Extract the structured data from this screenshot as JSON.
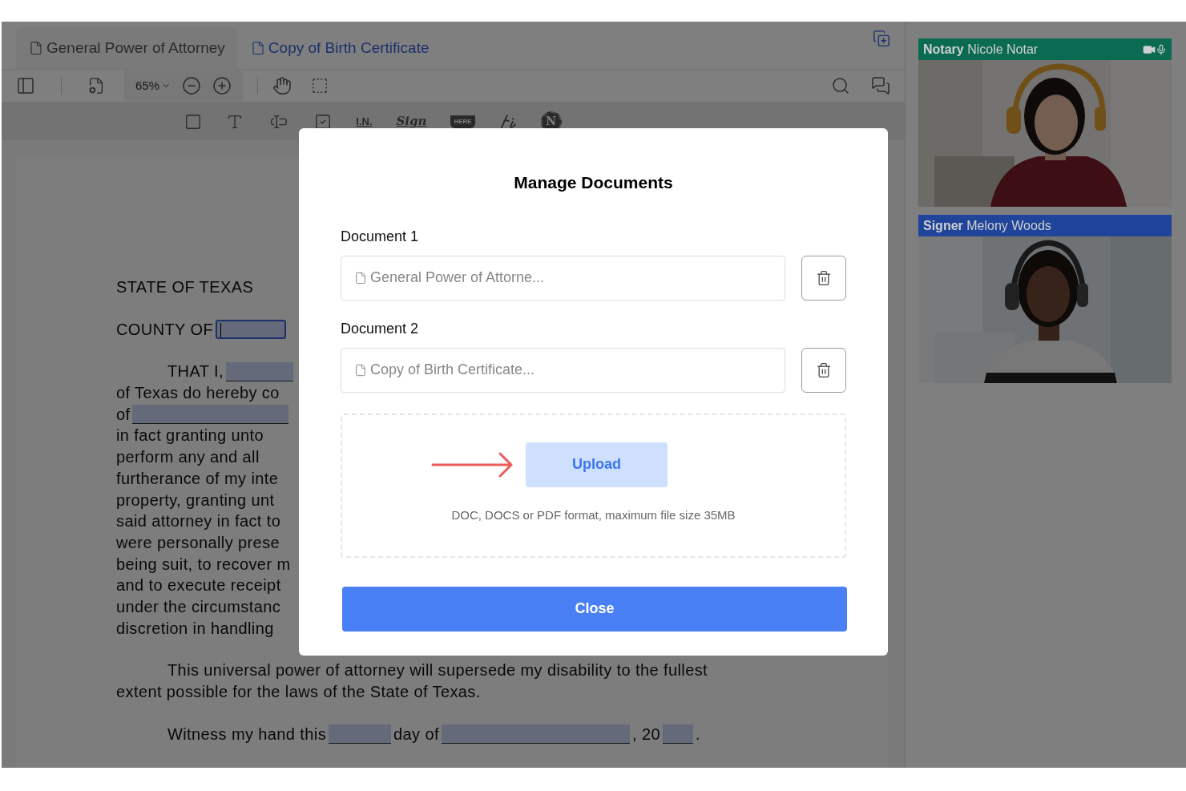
{
  "tabs": [
    {
      "label": "General Power of Attorney",
      "selected": false
    },
    {
      "label": "Copy of Birth Certificate",
      "selected": true
    }
  ],
  "toolbar": {
    "zoom": "65%"
  },
  "field_tools": [
    {
      "kind": "square"
    },
    {
      "kind": "letter"
    },
    {
      "kind": "textbox"
    },
    {
      "kind": "checkbox"
    },
    {
      "kind": "caption",
      "label": "I.N."
    },
    {
      "kind": "script",
      "label": "Sign"
    },
    {
      "kind": "stamp",
      "label": "HERE"
    },
    {
      "kind": "initials"
    },
    {
      "kind": "seal",
      "label": "N"
    }
  ],
  "document": {
    "blocks": [
      {
        "lines": [
          {
            "indent": false,
            "segments": [
              {
                "kind": "text",
                "text": "STATE OF TEXAS"
              }
            ]
          }
        ]
      },
      {
        "lines": [
          {
            "indent": false,
            "segments": [
              {
                "kind": "text",
                "text": "COUNTY OF"
              },
              {
                "kind": "blank",
                "focused": true
              }
            ]
          }
        ]
      },
      {
        "lines": [
          {
            "indent": true,
            "segments": [
              {
                "kind": "text",
                "text": "THAT I,"
              },
              {
                "kind": "blank",
                "focused": false
              }
            ]
          },
          {
            "indent": false,
            "segments": [
              {
                "kind": "text",
                "text": "of Texas do hereby co"
              }
            ]
          },
          {
            "indent": false,
            "segments": [
              {
                "kind": "text",
                "text": "of"
              },
              {
                "kind": "blank",
                "focused": false
              }
            ]
          },
          {
            "indent": false,
            "segments": [
              {
                "kind": "text",
                "text": "in fact granting unto"
              }
            ]
          },
          {
            "indent": false,
            "segments": [
              {
                "kind": "text",
                "text": "perform any and all"
              }
            ]
          },
          {
            "indent": false,
            "segments": [
              {
                "kind": "text",
                "text": "furtherance of my inte"
              }
            ]
          },
          {
            "indent": false,
            "segments": [
              {
                "kind": "text",
                "text": "property, granting unt"
              }
            ]
          },
          {
            "indent": false,
            "segments": [
              {
                "kind": "text",
                "text": "said attorney in fact to"
              }
            ]
          },
          {
            "indent": false,
            "segments": [
              {
                "kind": "text",
                "text": "were personally prese"
              }
            ]
          },
          {
            "indent": false,
            "segments": [
              {
                "kind": "text",
                "text": "being suit, to recover m"
              }
            ]
          },
          {
            "indent": false,
            "segments": [
              {
                "kind": "text",
                "text": "and to execute receipt"
              }
            ]
          },
          {
            "indent": false,
            "segments": [
              {
                "kind": "text",
                "text": "under the circumstanc"
              }
            ]
          },
          {
            "indent": false,
            "segments": [
              {
                "kind": "text",
                "text": "discretion in handling"
              }
            ]
          }
        ]
      },
      {
        "lines": [
          {
            "indent": true,
            "segments": [
              {
                "kind": "text",
                "text": "This universal power of attorney will supersede my disability to the fullest"
              }
            ]
          },
          {
            "indent": false,
            "segments": [
              {
                "kind": "text",
                "text": "extent possible for the laws of the State of Texas."
              }
            ]
          }
        ]
      },
      {
        "lines": [
          {
            "indent": true,
            "segments": [
              {
                "kind": "text",
                "text": "Witness my hand this"
              },
              {
                "kind": "blank",
                "focused": false
              },
              {
                "kind": "text",
                "text": "day of"
              },
              {
                "kind": "blank",
                "focused": false
              },
              {
                "kind": "text",
                "text": ", 20"
              },
              {
                "kind": "blank",
                "focused": false
              },
              {
                "kind": "text",
                "text": "."
              }
            ]
          }
        ]
      }
    ]
  },
  "participants": [
    {
      "role": "Notary",
      "name": "Nicole Notar",
      "color": "#0b6b52",
      "av_controls": true
    },
    {
      "role": "Signer",
      "name": "Melony Woods",
      "color": "#1f4499",
      "av_controls": false
    }
  ],
  "modal": {
    "title": "Manage Documents",
    "documents": [
      {
        "label": "Document 1",
        "value": "General Power of Attorne..."
      },
      {
        "label": "Document 2",
        "value": "Copy of Birth Certificate..."
      }
    ],
    "upload": {
      "button": "Upload",
      "hint": "DOC, DOCS or PDF format, maximum file size 35MB"
    },
    "close": "Close"
  }
}
